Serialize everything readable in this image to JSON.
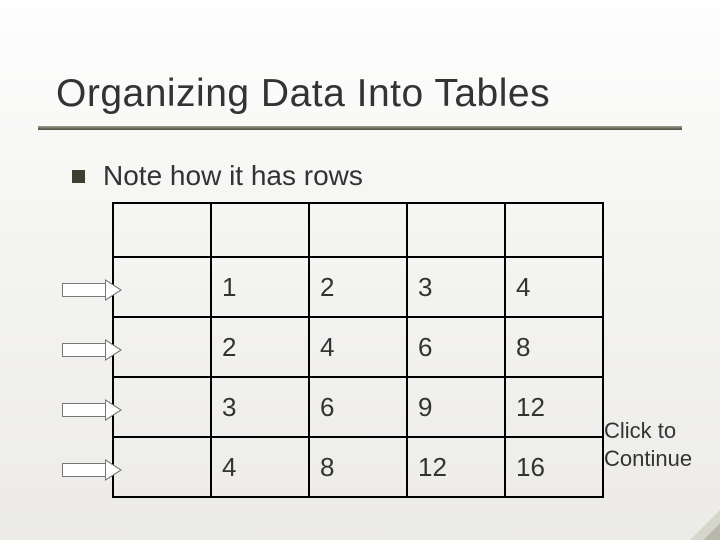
{
  "title": "Organizing Data Into Tables",
  "bullet_text": "Note how it has rows",
  "cta_line1": "Click to",
  "cta_line2": "Continue",
  "chart_data": {
    "type": "table",
    "columns": 5,
    "rows": [
      [
        "",
        "",
        "",
        "",
        ""
      ],
      [
        "",
        "1",
        "2",
        "3",
        "4"
      ],
      [
        "",
        "2",
        "4",
        "6",
        "8"
      ],
      [
        "",
        "3",
        "6",
        "9",
        "12"
      ],
      [
        "",
        "4",
        "8",
        "12",
        "16"
      ]
    ]
  }
}
